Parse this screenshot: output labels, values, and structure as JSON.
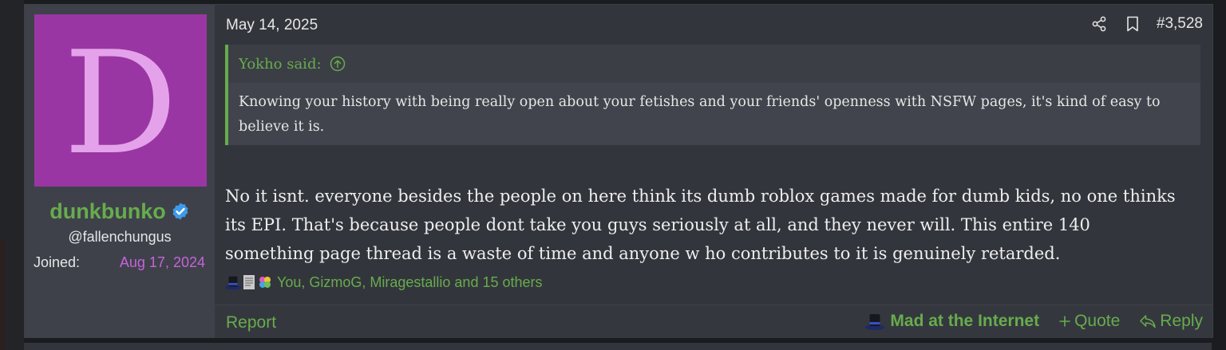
{
  "post": {
    "date": "May 14, 2025",
    "number": "#3,528",
    "share_icon": "share-icon",
    "bookmark_icon": "bookmark-icon"
  },
  "user": {
    "avatar_letter": "D",
    "avatar_color": "#9a36a3",
    "name": "dunkbunko",
    "handle": "@fallenchungus",
    "joined_label": "Joined:",
    "joined_date": "Aug 17, 2024",
    "name_color": "#67ac4d"
  },
  "quote": {
    "author": "Yokho said:",
    "text": "Knowing your history with being really open about your fetishes and your friends' openness with NSFW pages, it's kind of easy to believe it is."
  },
  "message": "No it isnt. everyone besides the people on here think its dumb roblox games made for dumb kids, no one thinks its EPI. That's because people dont take you guys seriously at all, and they never will. This entire 140 something page thread is a waste of time and anyone w ho contributes to it is genuinely retarded.",
  "reactions": {
    "icons": [
      "top-hat-icon",
      "scroll-icon",
      "puzzle-icon"
    ],
    "text": "You, GizmoG, Miragestallio and 15 others"
  },
  "footer": {
    "report": "Report",
    "reaction_label": "Mad at the Internet",
    "quote": "Quote",
    "reply": "Reply"
  },
  "colors": {
    "accent": "#67ac4d",
    "joined_date": "#c663d9",
    "background": "#33353c"
  }
}
